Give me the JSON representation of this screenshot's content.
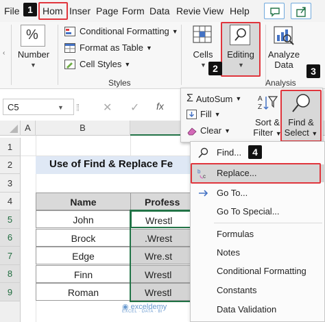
{
  "tabs": [
    "File",
    "Hom",
    "Inser",
    "Page",
    "Form",
    "Data",
    "Revie",
    "View",
    "Help"
  ],
  "ribbon": {
    "clipboard_cmds": {
      "number_label": "Number",
      "conditional_formatting": "Conditional Formatting",
      "format_as_table": "Format as Table",
      "cell_styles": "Cell Styles"
    },
    "styles_group_label": "Styles",
    "cells_label": "Cells",
    "editing_label": "Editing",
    "analyze_label_1": "Analyze",
    "analyze_label_2": "Data",
    "analysis_group_label": "Analysis"
  },
  "editing_panel": {
    "autosum": "AutoSum",
    "fill": "Fill",
    "clear": "Clear",
    "sort_label_1": "Sort &",
    "sort_label_2": "Filter",
    "find_label_1": "Find &",
    "find_label_2": "Select"
  },
  "badges": [
    "1",
    "2",
    "3",
    "4"
  ],
  "formula_bar": {
    "name_box": "C5",
    "fx": "fx"
  },
  "sheet": {
    "columns": [
      "A",
      "B"
    ],
    "rows": [
      "1",
      "2",
      "3",
      "4",
      "5",
      "6",
      "7",
      "8",
      "9"
    ],
    "title": "Use of Find & Replace Fe",
    "header_name": "Name",
    "header_profession": "Profess",
    "names": [
      "John",
      "Brock",
      "Edge",
      "Finn",
      "Roman"
    ],
    "professions": [
      "Wrestl",
      ".Wrest",
      "Wre.st",
      "Wrestl",
      "Wrestl"
    ]
  },
  "find_menu": {
    "items": [
      "Find...",
      "Replace...",
      "Go To...",
      "Go To Special...",
      "Formulas",
      "Notes",
      "Conditional Formatting",
      "Constants",
      "Data Validation"
    ]
  },
  "watermark": {
    "name": "exceldemy",
    "sub": "EXCEL · DATA · BI"
  },
  "colors": {
    "accent_red": "#e0343b",
    "excel_green": "#217346",
    "title_fill": "#dfe8f5",
    "header_fill": "#d9d9d9",
    "selected_fill": "#d4d4d4"
  }
}
